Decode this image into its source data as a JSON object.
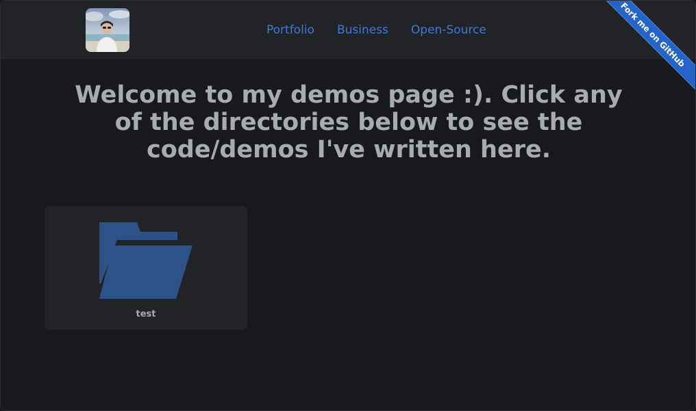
{
  "header": {
    "nav": [
      {
        "label": "Portfolio"
      },
      {
        "label": "Business"
      },
      {
        "label": "Open-Source"
      }
    ],
    "ribbon_label": "Fork me on GitHub"
  },
  "main": {
    "headline": "Welcome to my demos page :). Click any of the directories below to see the code/demos I've written here.",
    "directories": [
      {
        "name": "test",
        "icon": "folder-icon"
      }
    ]
  },
  "colors": {
    "background": "#18191c",
    "header_bg": "#222326",
    "nav_link": "#3f7ad6",
    "ribbon": "#2564c7",
    "folder": "#2c5288",
    "text": "#a8abb0"
  }
}
